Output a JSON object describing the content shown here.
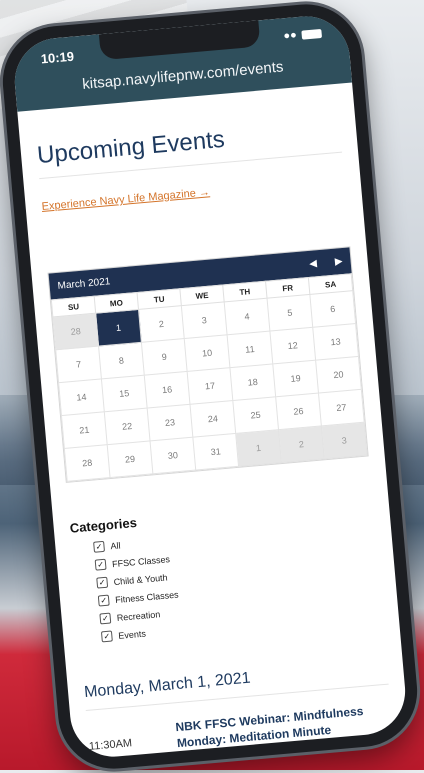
{
  "status": {
    "time": "10:19",
    "url": "kitsap.navylifepnw.com/events"
  },
  "page": {
    "title": "Upcoming Events",
    "magazine_link": "Experience Navy Life Magazine →"
  },
  "calendar": {
    "month_label": "March 2021",
    "prev": "◀",
    "next": "▶",
    "weekdays": [
      "SU",
      "MO",
      "TU",
      "WE",
      "TH",
      "FR",
      "SA"
    ],
    "weeks": [
      [
        "28",
        "1",
        "2",
        "3",
        "4",
        "5",
        "6"
      ],
      [
        "7",
        "8",
        "9",
        "10",
        "11",
        "12",
        "13"
      ],
      [
        "14",
        "15",
        "16",
        "17",
        "18",
        "19",
        "20"
      ],
      [
        "21",
        "22",
        "23",
        "24",
        "25",
        "26",
        "27"
      ],
      [
        "28",
        "29",
        "30",
        "31",
        "1",
        "2",
        "3"
      ]
    ]
  },
  "categories": {
    "title": "Categories",
    "items": [
      "All",
      "FFSC Classes",
      "Child & Youth",
      "Fitness Classes",
      "Recreation",
      "Events"
    ]
  },
  "events": {
    "day_heading": "Monday, March 1, 2021",
    "list": [
      {
        "time": "11:30AM",
        "title": "NBK FFSC Webinar: Mindfulness Monday: Meditation Minute"
      }
    ]
  }
}
